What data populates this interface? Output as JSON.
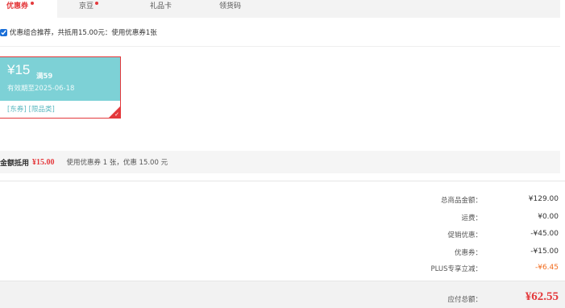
{
  "tabs": [
    {
      "label": "优惠券",
      "has_dot": true
    },
    {
      "label": "京豆",
      "has_dot": true
    },
    {
      "label": "礼品卡",
      "has_dot": false
    },
    {
      "label": "领货码",
      "has_dot": false
    }
  ],
  "recommend": {
    "checked": true,
    "text": "优惠组合推荐，共抵用15.00元：使用优惠券1张"
  },
  "coupon": {
    "amount": "¥15",
    "condition": "满59",
    "valid_until": "有效期至2025-06-18",
    "tags": [
      "[东券]",
      "[限品类]"
    ],
    "selected": true
  },
  "summary": {
    "label": "金额抵用",
    "amount": "¥15.00",
    "note": "使用优惠券 1 张，优惠 15.00 元"
  },
  "totals": [
    {
      "label": "总商品金额：",
      "value": "¥129.00",
      "style": "normal"
    },
    {
      "label": "运费：",
      "value": "¥0.00",
      "style": "normal"
    },
    {
      "label": "促销优惠：",
      "value": "-¥45.00",
      "style": "normal"
    },
    {
      "label": "优惠券：",
      "value": "-¥15.00",
      "style": "normal"
    },
    {
      "label": "PLUS专享立减：",
      "value": "-¥6.45",
      "style": "orange"
    }
  ],
  "payable": {
    "label": "应付总额：",
    "value": "¥62.55"
  },
  "colors": {
    "accent": "#e4393c",
    "coupon_bg": "#7dd1d6",
    "plus_orange": "#f26b1d"
  }
}
